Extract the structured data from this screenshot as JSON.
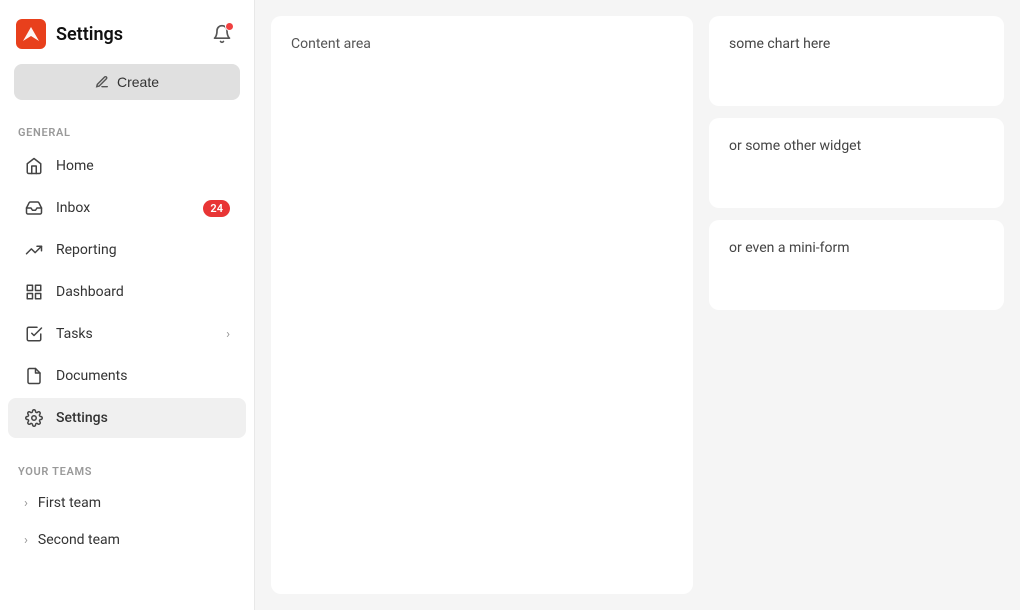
{
  "sidebar": {
    "title": "Settings",
    "create_label": "Create",
    "sections": {
      "general_label": "GENERAL",
      "teams_label": "YOUR TEAMS"
    },
    "nav_items": [
      {
        "id": "home",
        "label": "Home",
        "icon": "home-icon",
        "badge": null,
        "chevron": false,
        "active": false
      },
      {
        "id": "inbox",
        "label": "Inbox",
        "icon": "inbox-icon",
        "badge": "24",
        "chevron": false,
        "active": false
      },
      {
        "id": "reporting",
        "label": "Reporting",
        "icon": "reporting-icon",
        "badge": null,
        "chevron": false,
        "active": false
      },
      {
        "id": "dashboard",
        "label": "Dashboard",
        "icon": "dashboard-icon",
        "badge": null,
        "chevron": false,
        "active": false
      },
      {
        "id": "tasks",
        "label": "Tasks",
        "icon": "tasks-icon",
        "badge": null,
        "chevron": true,
        "active": false
      },
      {
        "id": "documents",
        "label": "Documents",
        "icon": "documents-icon",
        "badge": null,
        "chevron": false,
        "active": false
      },
      {
        "id": "settings",
        "label": "Settings",
        "icon": "settings-icon",
        "badge": null,
        "chevron": false,
        "active": true
      }
    ],
    "teams": [
      {
        "id": "first-team",
        "label": "First team"
      },
      {
        "id": "second-team",
        "label": "Second team"
      }
    ]
  },
  "content": {
    "area_label": "Content area"
  },
  "widgets": [
    {
      "id": "chart-widget",
      "text": "some chart here"
    },
    {
      "id": "other-widget",
      "text": "or some other widget"
    },
    {
      "id": "mini-form-widget",
      "text": "or even a mini-form"
    }
  ],
  "colors": {
    "accent": "#e83535",
    "active_bg": "#f0f0f0",
    "logo_color": "#e8401c"
  }
}
